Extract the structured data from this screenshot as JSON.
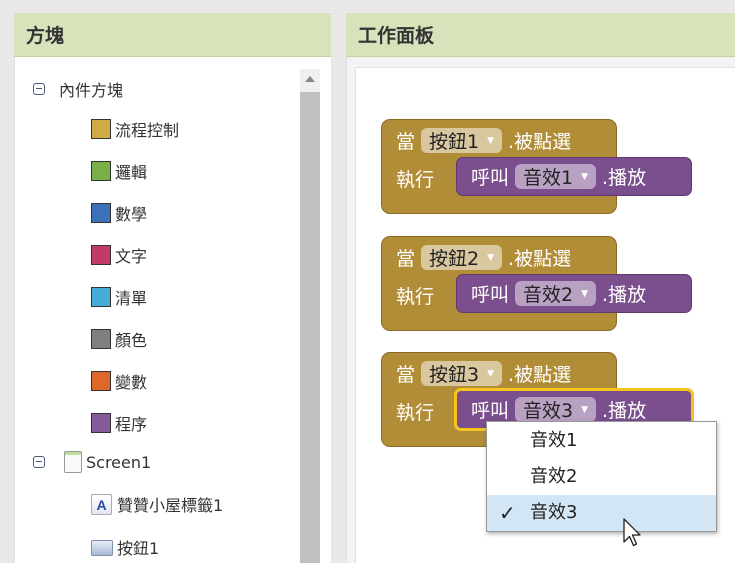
{
  "blocks_panel": {
    "title": "方塊",
    "builtin": {
      "label": "內件方塊",
      "items": [
        {
          "label": "流程控制",
          "color": "#d0aa42"
        },
        {
          "label": "邏輯",
          "color": "#7ab04a"
        },
        {
          "label": "數學",
          "color": "#3a71b8"
        },
        {
          "label": "文字",
          "color": "#c23a6a"
        },
        {
          "label": "清單",
          "color": "#45acd8"
        },
        {
          "label": "顏色",
          "color": "#7f7f7f"
        },
        {
          "label": "變數",
          "color": "#e0672a"
        },
        {
          "label": "程序",
          "color": "#845a98"
        }
      ]
    },
    "screen": {
      "label": "Screen1",
      "components": [
        {
          "label": "贊贊小屋標籤1",
          "icon": "label-icon",
          "glyph": "A"
        },
        {
          "label": "按鈕1",
          "icon": "button-icon"
        }
      ]
    }
  },
  "workspace": {
    "title": "工作面板",
    "event_blocks": [
      {
        "when": "當",
        "component": "按鈕1",
        "event": ".被點選",
        "do": "執行",
        "call": "呼叫",
        "sound": "音效1",
        "method": ".播放"
      },
      {
        "when": "當",
        "component": "按鈕2",
        "event": ".被點選",
        "do": "執行",
        "call": "呼叫",
        "sound": "音效2",
        "method": ".播放"
      },
      {
        "when": "當",
        "component": "按鈕3",
        "event": ".被點選",
        "do": "執行",
        "call": "呼叫",
        "sound": "音效3",
        "method": ".播放"
      }
    ],
    "dropdown": {
      "options": [
        "音效1",
        "音效2",
        "音效3"
      ],
      "selected": "音效3",
      "check": "✓"
    },
    "colors": {
      "event_block": "#b18d37",
      "call_block": "#7b4f8e",
      "selection": "#f5c51d"
    }
  }
}
